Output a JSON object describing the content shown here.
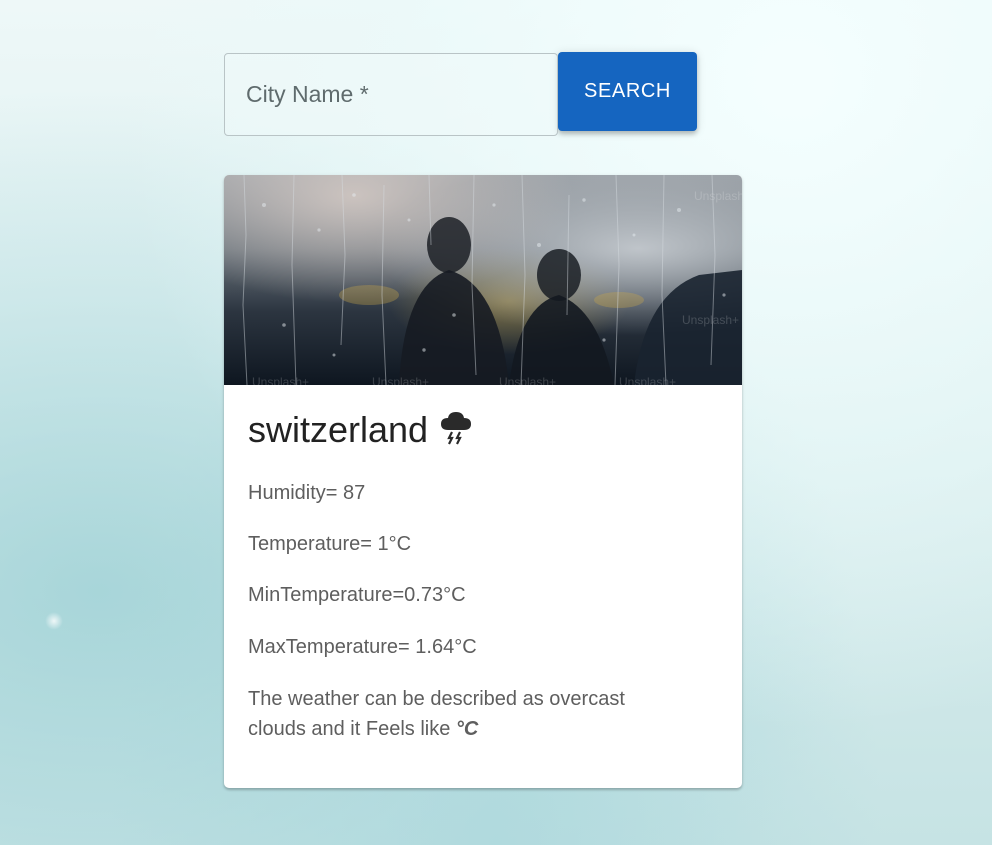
{
  "search": {
    "label": "City Name *",
    "value": "",
    "button_label": "SEARCH"
  },
  "card": {
    "image_watermark": "Unsplash+",
    "city": "switzerland",
    "weather_icon": "thunderstorm-cloud-icon",
    "humidity": "Humidity= 87",
    "temperature": "Temperature= 1°C",
    "min_temperature": "MinTemperature=0.73°C",
    "max_temperature": "MaxTemperature= 1.64°C",
    "description_text": "The weather can be described as overcast clouds and it Feels like ",
    "feels_like_unit": "°C"
  },
  "colors": {
    "button": "#1565c0",
    "card": "#ffffff",
    "text_secondary": "#5e5e5e"
  }
}
